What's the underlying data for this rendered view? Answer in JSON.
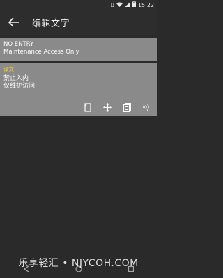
{
  "status_bar": {
    "time": "15:22"
  },
  "toolbar": {
    "title": "编辑文字",
    "back_icon": "arrow-left-icon"
  },
  "source": {
    "line1": "NO ENTRY",
    "line2": "Maintenance Access Only"
  },
  "translation": {
    "label": "译文",
    "line1": "禁止入内",
    "line2": "仅维护访问"
  },
  "actions": [
    "copy-icon",
    "move-icon",
    "clipboard-icon",
    "speaker-icon"
  ],
  "watermark": "乐享轻汇 • NJYCOH.COM",
  "colors": {
    "accent": "#f0c93a",
    "card": "#8a8a8a",
    "background": "#2a2a2a"
  }
}
